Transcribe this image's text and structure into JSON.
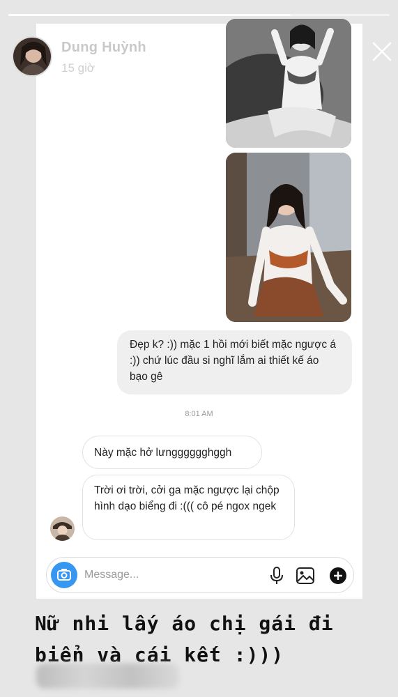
{
  "story": {
    "progress": 0.74,
    "username": "Dung Huỳnh",
    "time_ago": "15 giờ",
    "icons": {
      "more": "more-dots-icon",
      "close": "close-x-icon"
    }
  },
  "chat": {
    "sent_message": "Đẹp k? :)) mặc 1 hồi mới biết mặc ngược á :)) chứ lúc đầu si nghĩ lắm ai thiết kế áo bạo gê",
    "timestamp": "8:01 AM",
    "received": [
      "Này mặc hở lưngggggghggh",
      "Trời ơi trời, cởi ga mặc ngược lại chộp hình dạo biểng đi :((( cô pé ngox ngek"
    ],
    "photos": [
      "bikini-photo-1",
      "bikini-photo-2"
    ]
  },
  "composer": {
    "placeholder": "Message...",
    "icons": [
      "camera-icon",
      "microphone-icon",
      "gallery-icon",
      "plus-circle-icon"
    ],
    "accent": "#3797f0"
  },
  "caption": {
    "line1": "Nữ nhi lấy áo chị gái đi",
    "line2": "biển và cái kết :)))"
  }
}
